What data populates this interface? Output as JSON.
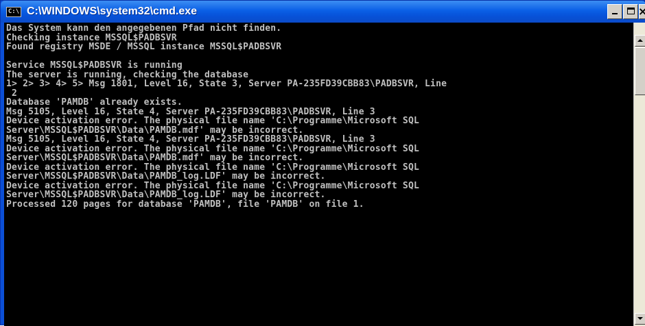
{
  "window": {
    "title": "C:\\WINDOWS\\system32\\cmd.exe",
    "icon_text": "C:\\"
  },
  "console": {
    "lines": [
      "Das System kann den angegebenen Pfad nicht finden.",
      "Checking instance MSSQL$PADBSVR",
      "Found registry MSDE / MSSQL instance MSSQL$PADBSVR",
      "",
      "Service MSSQL$PADBSVR is running",
      "The server is running, checking the database",
      "1> 2> 3> 4> 5> Msg 1801, Level 16, State 3, Server PA-235FD39CBB83\\PADBSVR, Line",
      " 2",
      "Database 'PAMDB' already exists.",
      "Msg 5105, Level 16, State 4, Server PA-235FD39CBB83\\PADBSVR, Line 3",
      "Device activation error. The physical file name 'C:\\Programme\\Microsoft SQL",
      "Server\\MSSQL$PADBSVR\\Data\\PAMDB.mdf' may be incorrect.",
      "Msg 5105, Level 16, State 4, Server PA-235FD39CBB83\\PADBSVR, Line 3",
      "Device activation error. The physical file name 'C:\\Programme\\Microsoft SQL",
      "Server\\MSSQL$PADBSVR\\Data\\PAMDB.mdf' may be incorrect.",
      "Device activation error. The physical file name 'C:\\Programme\\Microsoft SQL",
      "Server\\MSSQL$PADBSVR\\Data\\PAMDB_log.LDF' may be incorrect.",
      "Device activation error. The physical file name 'C:\\Programme\\Microsoft SQL",
      "Server\\MSSQL$PADBSVR\\Data\\PAMDB_log.LDF' may be incorrect.",
      "Processed 120 pages for database 'PAMDB', file 'PAMDB' on file 1."
    ]
  },
  "colors": {
    "titlebar": "#0a5fe6",
    "console_bg": "#000000",
    "console_text": "#c0c0c0"
  }
}
